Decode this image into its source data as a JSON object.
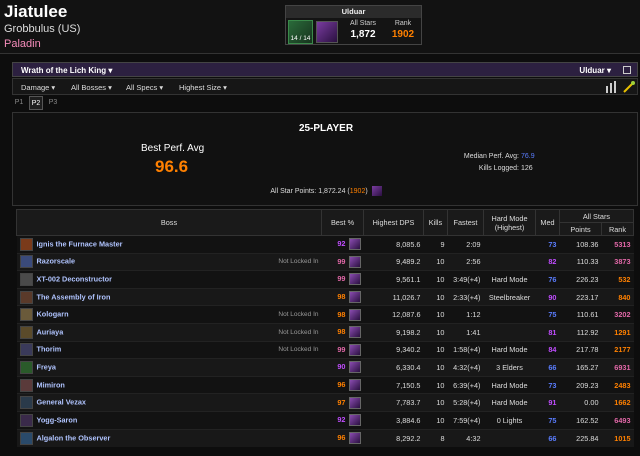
{
  "character": {
    "name": "Jiatulee",
    "realm": "Grobbulus (US)",
    "class": "Paladin"
  },
  "zone_box": {
    "title": "Ulduar",
    "kills": "14 / 14",
    "all_stars_label": "All Stars",
    "all_stars_value": "1,872",
    "rank_label": "Rank",
    "rank_value": "1902"
  },
  "expansion_bar": {
    "expansion": "Wrath of the Lich King ▾",
    "zone": "Ulduar ▾"
  },
  "filters": [
    "Damage ▾",
    "All Bosses ▾",
    "All Specs ▾",
    "Highest Size ▾"
  ],
  "pages": [
    "P1",
    "P2",
    "P3"
  ],
  "summary": {
    "title": "25-PLAYER",
    "best_perf_label": "Best Perf. Avg",
    "best_perf_value": "96.6",
    "median_label": "Median Perf. Avg:",
    "median_value": "76.9",
    "kills_label": "Kills Logged:",
    "kills_value": "126",
    "all_star_label": "All Star Points:",
    "all_star_value": "1,872.24",
    "all_star_rank_open": "(",
    "all_star_rank": "1902",
    "all_star_rank_close": ")"
  },
  "table": {
    "headers": {
      "boss": "Boss",
      "best": "Best %",
      "dps": "Highest DPS",
      "kills": "Kills",
      "fastest": "Fastest",
      "hardmode": "Hard Mode",
      "hardmode_sub": "(Highest)",
      "med": "Med",
      "allstars": "All Stars",
      "points": "Points",
      "rank": "Rank"
    },
    "rows": [
      {
        "boss": "Ignis the Furnace Master",
        "note": "",
        "best": "92",
        "best_color": "purple",
        "dps": "8,085.6",
        "kills": "9",
        "fastest": "2:09",
        "hm": "",
        "med": "73",
        "med_color": "blue",
        "points": "108.36",
        "rank": "5313",
        "rank_color": "pink",
        "icon": "#7a3a1a"
      },
      {
        "boss": "Razorscale",
        "note": "Not Locked In",
        "best": "99",
        "best_color": "pink",
        "dps": "9,489.2",
        "kills": "10",
        "fastest": "2:56",
        "hm": "",
        "med": "82",
        "med_color": "purple",
        "points": "110.33",
        "rank": "3873",
        "rank_color": "pink",
        "icon": "#3a4a7a"
      },
      {
        "boss": "XT-002 Deconstructor",
        "note": "",
        "best": "99",
        "best_color": "pink",
        "dps": "9,561.1",
        "kills": "10",
        "fastest": "3:49(+4)",
        "hm": "Hard Mode",
        "med": "76",
        "med_color": "blue",
        "points": "226.23",
        "rank": "532",
        "rank_color": "orange",
        "icon": "#4a4a4a"
      },
      {
        "boss": "The Assembly of Iron",
        "note": "",
        "best": "98",
        "best_color": "orange",
        "dps": "11,026.7",
        "kills": "10",
        "fastest": "2:33(+4)",
        "hm": "Steelbreaker",
        "med": "90",
        "med_color": "purple",
        "points": "223.17",
        "rank": "840",
        "rank_color": "orange",
        "icon": "#5a3a2a"
      },
      {
        "boss": "Kologarn",
        "note": "Not Locked In",
        "best": "98",
        "best_color": "orange",
        "dps": "12,087.6",
        "kills": "10",
        "fastest": "1:12",
        "hm": "",
        "med": "75",
        "med_color": "blue",
        "points": "110.61",
        "rank": "3202",
        "rank_color": "pink",
        "icon": "#6a5a3a"
      },
      {
        "boss": "Auriaya",
        "note": "Not Locked In",
        "best": "98",
        "best_color": "orange",
        "dps": "9,198.2",
        "kills": "10",
        "fastest": "1:41",
        "hm": "",
        "med": "81",
        "med_color": "purple",
        "points": "112.92",
        "rank": "1291",
        "rank_color": "orange",
        "icon": "#5a4a2a"
      },
      {
        "boss": "Thorim",
        "note": "Not Locked In",
        "best": "99",
        "best_color": "pink",
        "dps": "9,340.2",
        "kills": "10",
        "fastest": "1:58(+4)",
        "hm": "Hard Mode",
        "med": "84",
        "med_color": "purple",
        "points": "217.78",
        "rank": "2177",
        "rank_color": "orange",
        "icon": "#3a3a5a"
      },
      {
        "boss": "Freya",
        "note": "",
        "best": "90",
        "best_color": "purple",
        "dps": "6,330.4",
        "kills": "10",
        "fastest": "4:32(+4)",
        "hm": "3 Elders",
        "med": "66",
        "med_color": "blue",
        "points": "165.27",
        "rank": "6931",
        "rank_color": "pink",
        "icon": "#2a5a2a"
      },
      {
        "boss": "Mimiron",
        "note": "",
        "best": "96",
        "best_color": "orange",
        "dps": "7,150.5",
        "kills": "10",
        "fastest": "6:39(+4)",
        "hm": "Hard Mode",
        "med": "73",
        "med_color": "blue",
        "points": "209.23",
        "rank": "2483",
        "rank_color": "orange",
        "icon": "#5a3a3a"
      },
      {
        "boss": "General Vezax",
        "note": "",
        "best": "97",
        "best_color": "orange",
        "dps": "7,783.7",
        "kills": "10",
        "fastest": "5:28(+4)",
        "hm": "Hard Mode",
        "med": "91",
        "med_color": "purple",
        "points": "0.00",
        "rank": "1662",
        "rank_color": "orange",
        "icon": "#2a3a4a"
      },
      {
        "boss": "Yogg-Saron",
        "note": "",
        "best": "92",
        "best_color": "purple",
        "dps": "3,884.6",
        "kills": "10",
        "fastest": "7:59(+4)",
        "hm": "0 Lights",
        "med": "75",
        "med_color": "blue",
        "points": "162.52",
        "rank": "6493",
        "rank_color": "pink",
        "icon": "#3a2a4a"
      },
      {
        "boss": "Algalon the Observer",
        "note": "",
        "best": "96",
        "best_color": "orange",
        "dps": "8,292.2",
        "kills": "8",
        "fastest": "4:32",
        "hm": "",
        "med": "66",
        "med_color": "blue",
        "points": "225.84",
        "rank": "1015",
        "rank_color": "orange",
        "icon": "#2a4a6a"
      }
    ]
  }
}
